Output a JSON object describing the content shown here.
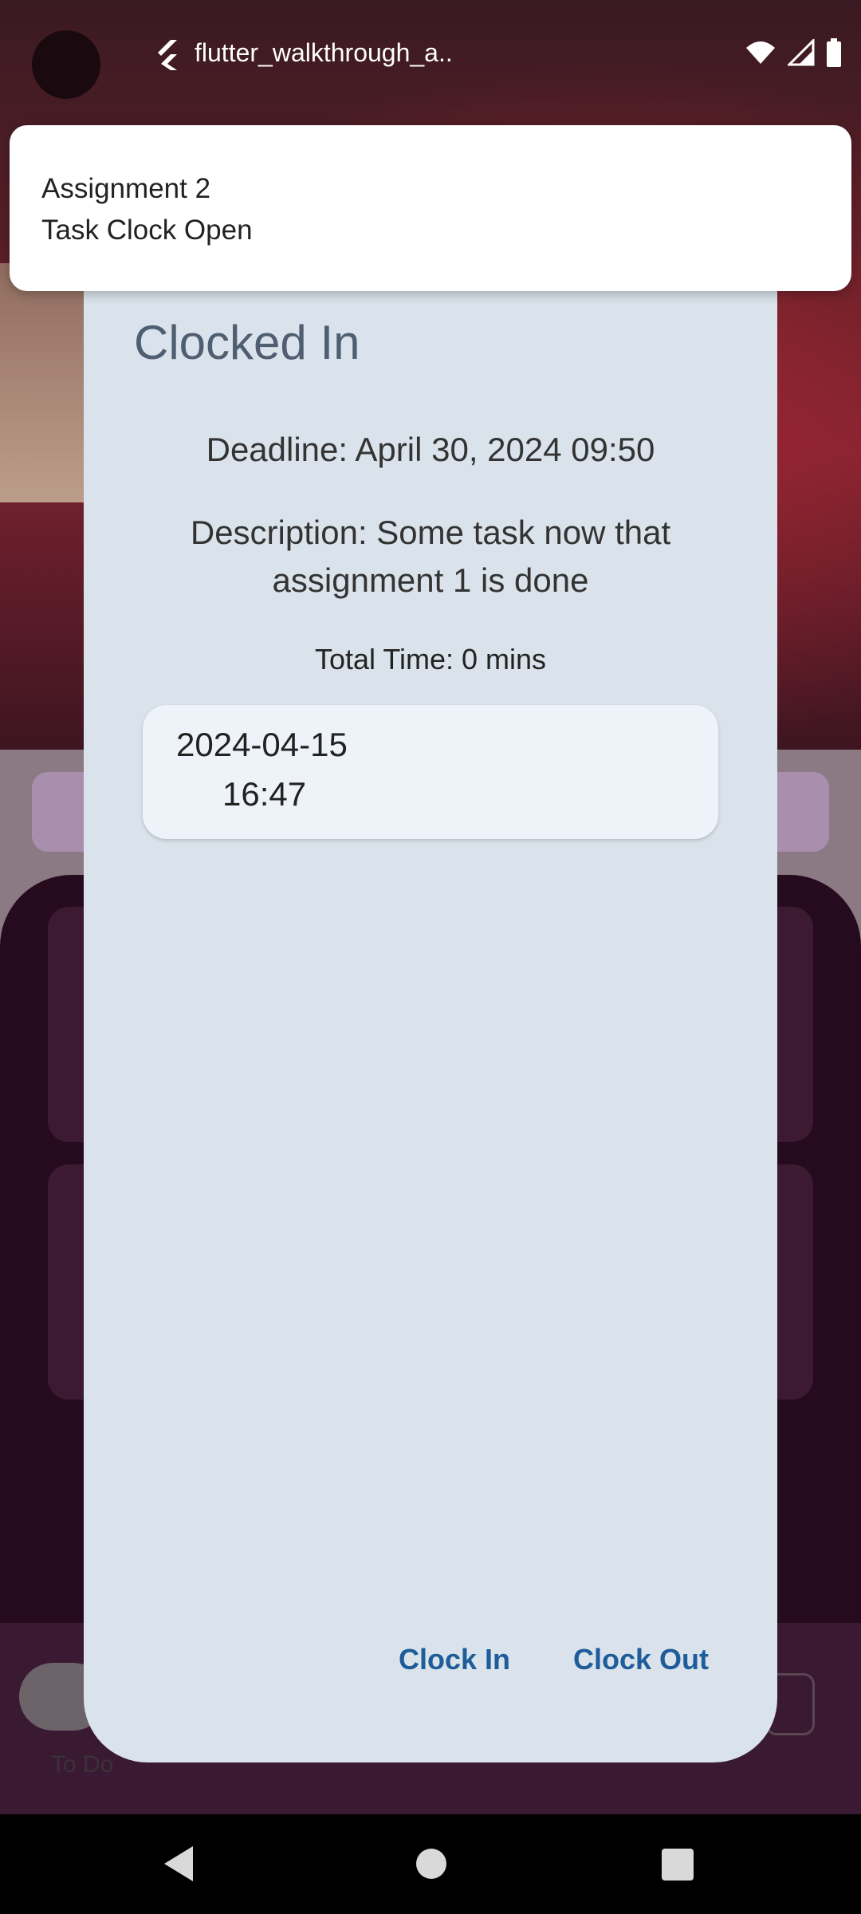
{
  "status_bar": {
    "app_title": "flutter_walkthrough_a..",
    "icons": [
      "flutter-icon",
      "wifi-icon",
      "signal-icon",
      "battery-icon"
    ]
  },
  "notification": {
    "title": "Assignment 2",
    "body": "Task Clock Open"
  },
  "dialog": {
    "title": "Clocked In",
    "deadline": "Deadline: April 30, 2024 09:50",
    "description": "Description: Some task now that assignment 1 is done",
    "total_time": "Total Time: 0 mins",
    "entries": [
      {
        "date": "2024-04-15",
        "time": "16:47"
      }
    ],
    "buttons": {
      "clock_in": "Clock In",
      "clock_out": "Clock Out"
    }
  },
  "background": {
    "nav_label": "To Do"
  },
  "colors": {
    "dialog_bg": "#dae3eb",
    "title_color": "#4f5e70",
    "button_color": "#1e5d9a",
    "card_bg": "#eef2f9"
  },
  "system_nav": {
    "icons": [
      "back-icon",
      "home-icon",
      "recents-icon"
    ]
  }
}
